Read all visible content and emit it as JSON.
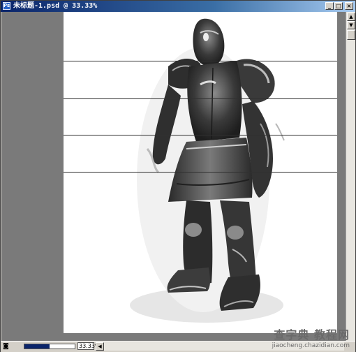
{
  "window": {
    "title": "未标题-1.psd @ 33.33%",
    "app_icon": "photoshop-document-icon",
    "controls": {
      "minimize": "minimize-icon",
      "maximize": "maximize-icon",
      "close": "close-icon"
    }
  },
  "canvas": {
    "background_color": "#ffffff",
    "subject": "armored-knight-sketch",
    "horizontal_guides": 4
  },
  "statusbar": {
    "icon": "navigator-icon",
    "zoom": "33.33%",
    "navigator_level": 0.5
  },
  "scrollbars": {
    "vertical": {
      "up": "arrow-up-icon",
      "down": "arrow-down-icon"
    },
    "horizontal": {
      "left": "arrow-left-icon",
      "right": "arrow-right-icon"
    }
  },
  "watermark": {
    "main": "查字典 教程网",
    "sub": "jiaocheng.chazidian.com"
  },
  "colors": {
    "titlebar_start": "#0a246a",
    "titlebar_end": "#a6caf0",
    "workspace": "#7a7a7a",
    "chrome": "#d4d0c8"
  }
}
